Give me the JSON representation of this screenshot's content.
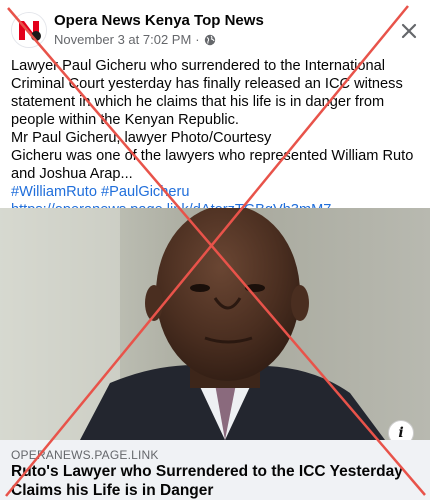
{
  "post": {
    "page_name": "Opera News Kenya Top News",
    "timestamp": "November 3 at 7:02 PM",
    "separator": "·",
    "icons": {
      "avatar": "opera-news-logo",
      "privacy": "globe-icon",
      "close": "close-icon",
      "info": "info-icon"
    },
    "text_lines": [
      "Lawyer Paul Gicheru who surrendered to the International Criminal Court yesterday has finally released an ICC witness statement in which he claims that his life is in danger from people within the Kenyan Republic.",
      "Mr Paul Gicheru, lawyer Photo/Courtesy",
      "Gicheru was one of the lawyers who represented William Ruto and Joshua Arap..."
    ],
    "hashtags": "#WilliamRuto #PaulGicheru",
    "url": "https://operanews.page.link/dAtorzTGBgVh3mM7"
  },
  "link_preview": {
    "domain": "OPERANEWS.PAGE.LINK",
    "headline": "Ruto's Lawyer who Surrendered to the ICC Yesterday Claims his Life is in Danger"
  },
  "colors": {
    "brand_red": "#e3001b",
    "cross_red": "#e8534a",
    "link_blue": "#216fdb"
  }
}
